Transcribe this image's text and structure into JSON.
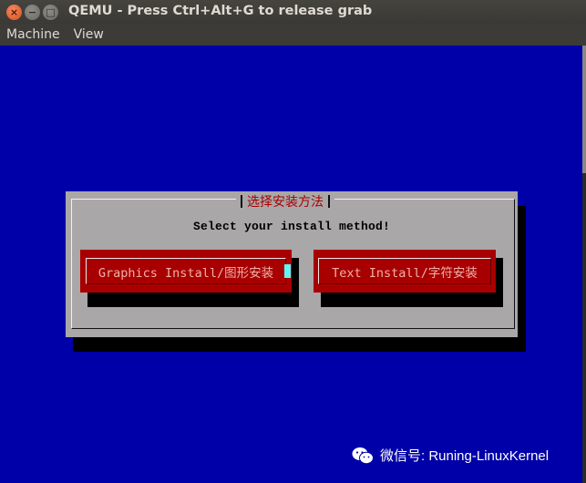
{
  "window": {
    "title": "QEMU - Press Ctrl+Alt+G to release grab",
    "controls": {
      "close": "×",
      "minimize": "−",
      "maximize": "□"
    }
  },
  "menu": [
    "Machine",
    "View"
  ],
  "installer": {
    "dialog_title": "选择安装方法",
    "prompt": "Select your install method!",
    "buttons": [
      {
        "label": "Graphics Install/图形安装",
        "focused": true
      },
      {
        "label": "Text Install/字符安装",
        "focused": false
      }
    ]
  },
  "watermark": {
    "text": "微信号: Runing-LinuxKernel",
    "icon": "wechat-icon"
  },
  "colors": {
    "screen_bg": "#0000a8",
    "dialog_bg": "#aaa7a8",
    "button_bg": "#a80000",
    "title_text": "#a80000",
    "cursor": "#5ff5f5"
  }
}
